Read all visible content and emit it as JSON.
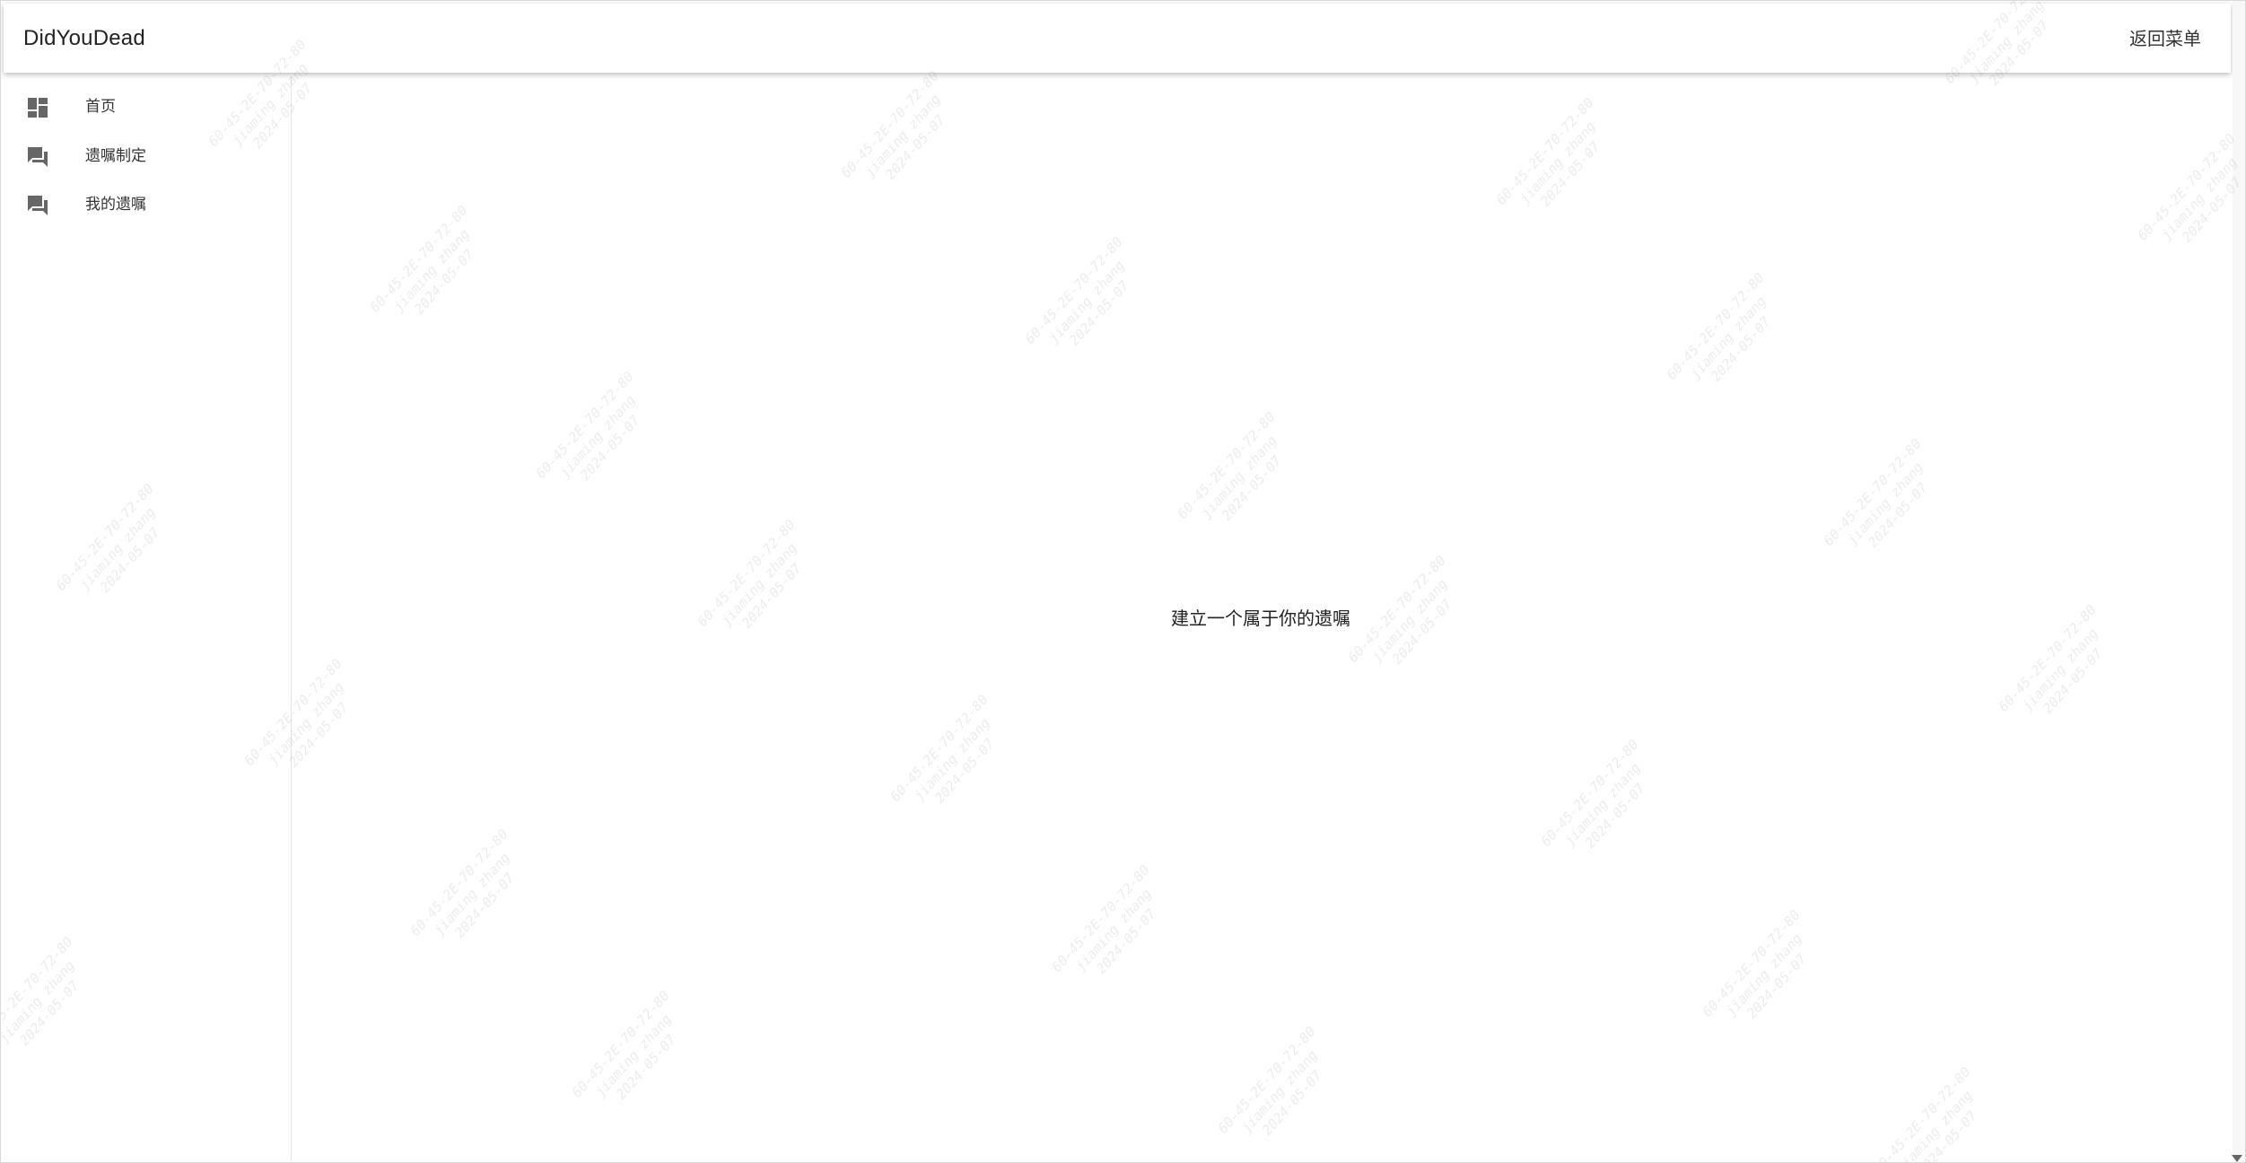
{
  "app": {
    "title": "DidYouDead",
    "back_menu_label": "返回菜单"
  },
  "sidebar": {
    "items": [
      {
        "label": "首页",
        "icon": "dashboard-icon"
      },
      {
        "label": "遗嘱制定",
        "icon": "forum-icon"
      },
      {
        "label": "我的遗嘱",
        "icon": "forum-icon"
      }
    ]
  },
  "main": {
    "message": "建立一个属于你的遗嘱"
  },
  "watermark": {
    "line1": "60-45-2E-70-72-80",
    "line2": "jiaming zhang",
    "line3": "2024-05-07"
  },
  "colors": {
    "icon": "#666666",
    "text": "#222222",
    "border": "#e3e3e3"
  }
}
